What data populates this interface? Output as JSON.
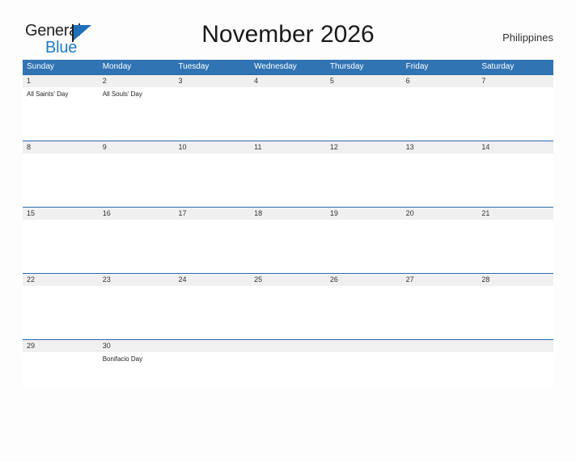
{
  "brand": {
    "name_part1": "General",
    "name_part2": "Blue",
    "flag_icon": "flag-triangle-icon"
  },
  "header": {
    "title": "November 2026",
    "country": "Philippines"
  },
  "colors": {
    "header_blue": "#3174b4",
    "row_divider_blue": "#2a6ba8",
    "date_band_gray": "#f0f0f0",
    "brand_blue": "#1f7ac4",
    "page_background": "#fdfdfd"
  },
  "calendar": {
    "weekday_headers": [
      "Sunday",
      "Monday",
      "Tuesday",
      "Wednesday",
      "Thursday",
      "Friday",
      "Saturday"
    ],
    "weeks": [
      {
        "dates": [
          "1",
          "2",
          "3",
          "4",
          "5",
          "6",
          "7"
        ],
        "events": [
          "All Saints' Day",
          "All Souls' Day",
          "",
          "",
          "",
          "",
          ""
        ]
      },
      {
        "dates": [
          "8",
          "9",
          "10",
          "11",
          "12",
          "13",
          "14"
        ],
        "events": [
          "",
          "",
          "",
          "",
          "",
          "",
          ""
        ]
      },
      {
        "dates": [
          "15",
          "16",
          "17",
          "18",
          "19",
          "20",
          "21"
        ],
        "events": [
          "",
          "",
          "",
          "",
          "",
          "",
          ""
        ]
      },
      {
        "dates": [
          "22",
          "23",
          "24",
          "25",
          "26",
          "27",
          "28"
        ],
        "events": [
          "",
          "",
          "",
          "",
          "",
          "",
          ""
        ]
      },
      {
        "dates": [
          "29",
          "30",
          "",
          "",
          "",
          "",
          ""
        ],
        "events": [
          "",
          "Bonifacio Day",
          "",
          "",
          "",
          "",
          ""
        ]
      }
    ]
  }
}
